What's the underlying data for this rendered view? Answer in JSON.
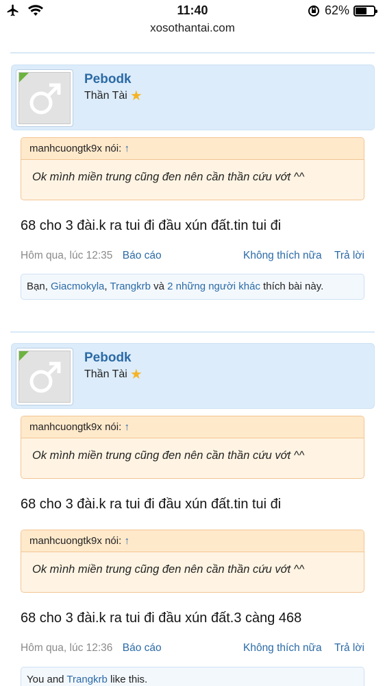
{
  "status": {
    "time": "11:40",
    "battery": "62%",
    "battery_level": 0.62,
    "url": "xosothantai.com"
  },
  "post1": {
    "username": "Pebodk",
    "usertitle": "Thần Tài",
    "quote": {
      "author": "manhcuongtk9x nói:",
      "arrow": "↑",
      "text": "Ok mình miền trung cũng đen nên cần thần cứu vớt ^^"
    },
    "message": "68 cho 3 đài.k ra tui đi đầu xún đất.tin tui đi",
    "meta": {
      "date": "Hôm qua, lúc 12:35",
      "report": "Báo cáo",
      "unlike": "Không thích nữa",
      "reply": "Trả lời"
    },
    "likes": {
      "prefix": "Bạn, ",
      "user1": "Giacmokyla",
      "sep": ", ",
      "user2": "Trangkrb",
      "and": " và ",
      "others": "2 những người khác",
      "suffix": " thích bài này."
    }
  },
  "post2": {
    "username": "Pebodk",
    "usertitle": "Thần Tài",
    "quote1": {
      "author": "manhcuongtk9x nói:",
      "arrow": "↑",
      "text": "Ok mình miền trung cũng đen nên cần thần cứu vớt ^^"
    },
    "message1": "68 cho 3 đài.k ra tui đi đầu xún đất.tin tui đi",
    "quote2": {
      "author": "manhcuongtk9x nói:",
      "arrow": "↑",
      "text": "Ok mình miền trung cũng đen nên cần thần cứu vớt ^^"
    },
    "message2": "68 cho 3 đài.k ra tui đi đầu xún đất.3 càng 468",
    "meta": {
      "date": "Hôm qua, lúc 12:36",
      "report": "Báo cáo",
      "unlike": "Không thích nữa",
      "reply": "Trả lời"
    },
    "likes": {
      "prefix": "You and ",
      "user1": "Trangkrb",
      "suffix": " like this."
    }
  }
}
